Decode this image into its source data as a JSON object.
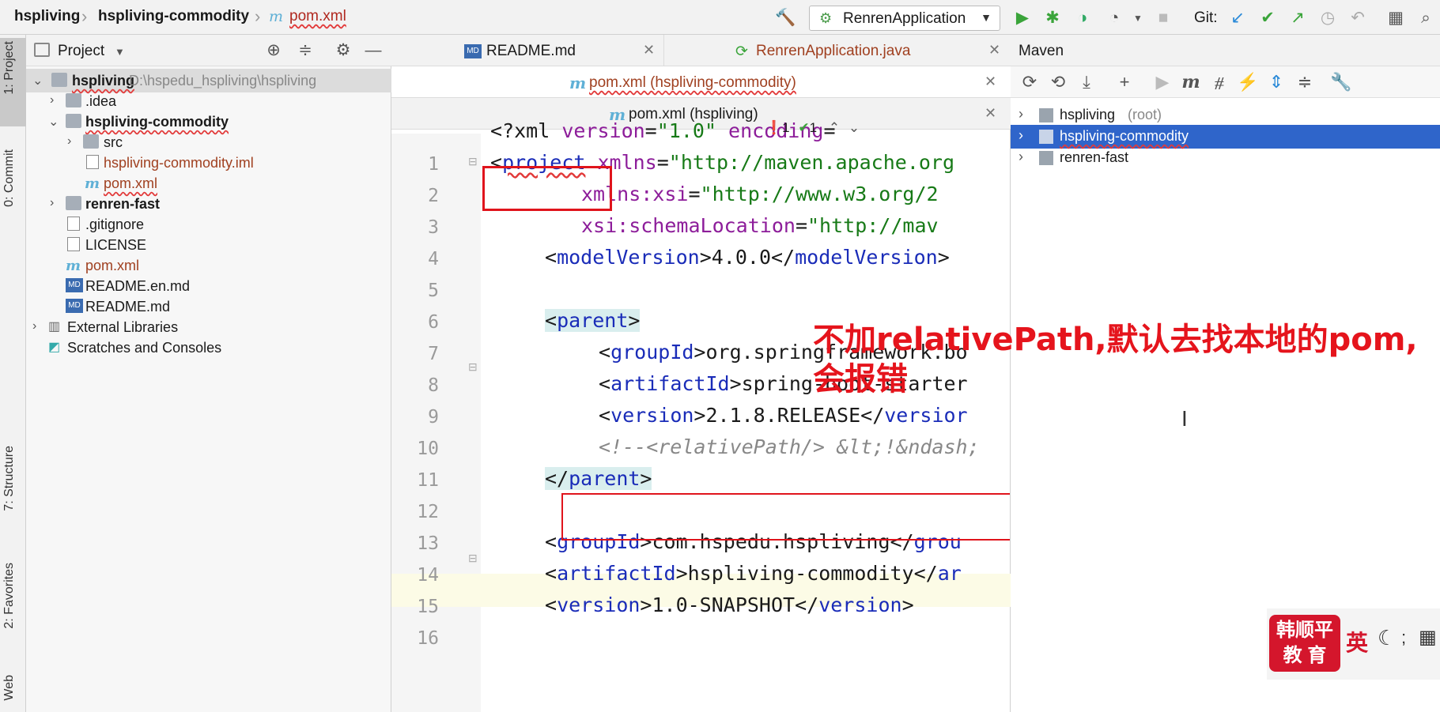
{
  "breadcrumb": {
    "project": "hspliving",
    "module": "hspliving-commodity",
    "file": "pom.xml"
  },
  "toolbar": {
    "run_config": "RenrenApplication",
    "git_label": "Git:"
  },
  "left_strip": {
    "project_tab": "1: Project",
    "commit_tab": "0: Commit",
    "structure_tab": "7: Structure",
    "favorites_tab": "2: Favorites",
    "web_tab": "Web"
  },
  "project_panel": {
    "title": "Project",
    "tree": [
      {
        "label": "hspliving",
        "path": "D:\\hspedu_hspliving\\hspliving"
      },
      {
        "label": ".idea"
      },
      {
        "label": "hspliving-commodity"
      },
      {
        "label": "src"
      },
      {
        "label": "hspliving-commodity.iml"
      },
      {
        "label": "pom.xml"
      },
      {
        "label": "renren-fast"
      },
      {
        "label": ".gitignore"
      },
      {
        "label": "LICENSE"
      },
      {
        "label": "pom.xml"
      },
      {
        "label": "README.en.md"
      },
      {
        "label": "README.md"
      },
      {
        "label": "External Libraries"
      },
      {
        "label": "Scratches and Consoles"
      }
    ]
  },
  "editor": {
    "tabs_row1": [
      "README.md",
      "RenrenApplication.java"
    ],
    "tab_row2": "pom.xml (hspliving-commodity)",
    "tab_row3": "pom.xml (hspliving)",
    "inspection": {
      "errors": "1",
      "checks": "1"
    },
    "line_numbers": [
      "1",
      "2",
      "3",
      "4",
      "5",
      "6",
      "7",
      "8",
      "9",
      "10",
      "11",
      "12",
      "13",
      "14",
      "15",
      "16"
    ],
    "code": {
      "l1_pi": "<?xml ",
      "l1_attr": "version",
      "l1_eq": "=",
      "l1_val": "\"1.0\"",
      "l1_attr2": " encoding",
      "l1_eq2": "=",
      "l2_open": "<",
      "l2_tag": "project",
      "l2_attr": " xmlns",
      "l2_eq": "=",
      "l2_val": "\"http://maven.apache.org",
      "l3_attr": "xmlns:xsi",
      "l3_eq": "=",
      "l3_val": "\"http://www.w3.org/2",
      "l4_attr": "xsi:schemaLocation",
      "l4_eq": "=",
      "l4_val": "\"http://mav",
      "l5_open": "<",
      "l5_tag": "modelVersion",
      "l5_mid": ">4.0.0</",
      "l5_tag2": "modelVersion",
      "l5_close": ">",
      "l7_open": "<",
      "l7_tag": "parent",
      "l7_close": ">",
      "l8_open": "<",
      "l8_tag": "groupId",
      "l8_rest": ">org.springframework.bo",
      "l9_open": "<",
      "l9_tag": "artifactId",
      "l9_rest": ">spring-boot-starter",
      "l10_open": "<",
      "l10_tag": "version",
      "l10_mid": ">2.1.8.RELEASE</",
      "l10_tag2": "versior",
      "l11_comment": "<!--<relativePath/> &lt;!&ndash;",
      "l12_open": "</",
      "l12_tag": "parent",
      "l12_close": ">",
      "l14_open": "<",
      "l14_tag": "groupId",
      "l14_mid": ">com.hspedu.hspliving</",
      "l14_tag2": "grou",
      "l15_open": "<",
      "l15_tag": "artifactId",
      "l15_mid": ">hspliving-commodity</",
      "l15_tag2": "ar",
      "l16_open": "<",
      "l16_tag": "version",
      "l16_mid": ">1.0-SNAPSHOT</",
      "l16_tag2": "version",
      "l16_close": ">"
    }
  },
  "maven": {
    "title": "Maven",
    "items": [
      {
        "label": "hspliving",
        "suffix": "(root)"
      },
      {
        "label": "hspliving-commodity"
      },
      {
        "label": "renren-fast"
      }
    ]
  },
  "annotation": {
    "line1": "不加relativePath,默认去找本地的pom,",
    "line2": "会报错"
  },
  "watermark": {
    "line1": "韩顺平",
    "line2": "教 育",
    "ime": "英"
  },
  "colors": {
    "annotation_red": "#e5141c",
    "selection_blue": "#2f65ca",
    "tag_blue": "#1a2cb8"
  }
}
